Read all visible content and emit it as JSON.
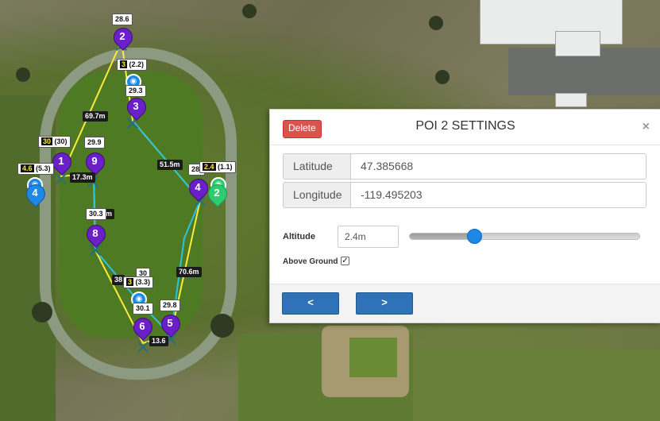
{
  "dialog": {
    "title": "POI 2 SETTINGS",
    "delete_label": "Delete",
    "close_label": "×",
    "latitude": {
      "label": "Latitude",
      "value": "47.385668"
    },
    "longitude": {
      "label": "Longitude",
      "value": "-119.495203"
    },
    "altitude": {
      "label": "Altitude",
      "value": "2.4m",
      "slider_fraction": 0.28
    },
    "above_ground": {
      "label": "Above Ground",
      "checked": true,
      "mark": "✓"
    },
    "prev_label": "<",
    "next_label": ">"
  },
  "map": {
    "waypoints": [
      {
        "num": "1"
      },
      {
        "num": "2"
      },
      {
        "num": "3"
      },
      {
        "num": "4"
      },
      {
        "num": "5"
      },
      {
        "num": "6"
      },
      {
        "num": "8"
      },
      {
        "num": "9"
      }
    ],
    "pois": [
      {
        "num": "4",
        "color": "#1e88e5"
      },
      {
        "num": "2",
        "color": "#2ecc71"
      }
    ],
    "distance_labels": [
      "69.7m",
      "17.3m",
      "51.5m",
      "70.6m",
      "38",
      "13.6",
      "m"
    ],
    "altitude_labels": {
      "wp2": "28.6",
      "wp3": "29.3",
      "wp9": "29.9",
      "wp8": "30.3",
      "wp6a": "30",
      "wp6b": "30.1",
      "wp5": "29.8",
      "wp4": "28.",
      "poi3_yellow": "3",
      "poi3_white": "(2.2)",
      "poi_left_yellow": "30",
      "poi_left_white": "(30)",
      "poi4_yellow": "4.6",
      "poi4_white": "(5.3)",
      "poi2_yellow": "2.4",
      "poi2_white": "(1.1)",
      "poi_bottom_yellow": "3",
      "poi_bottom_white": "(3.3)"
    },
    "path_color": "#ffeb3b",
    "poi_link_color": "#29c4e0"
  }
}
